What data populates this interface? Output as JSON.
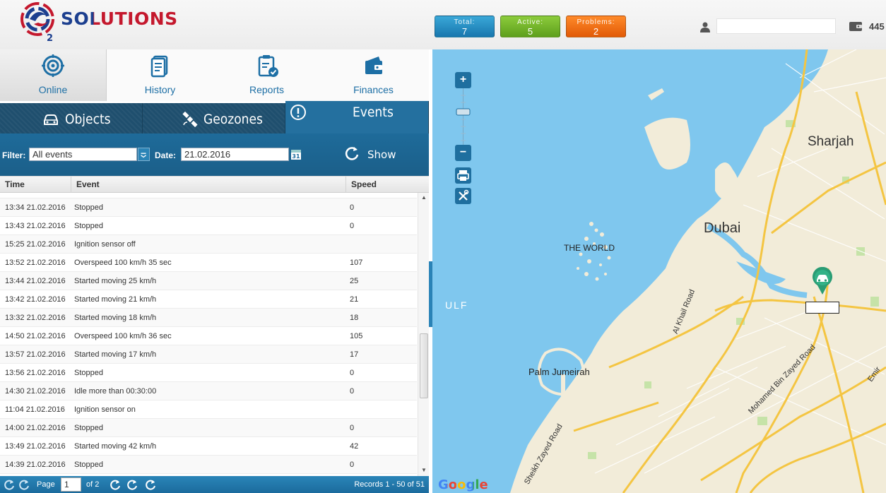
{
  "header": {
    "logo_text": "SOLUTIONS",
    "counters": {
      "total": {
        "label": "Total:",
        "value": "7"
      },
      "active": {
        "label": "Active:",
        "value": "5"
      },
      "problems": {
        "label": "Problems:",
        "value": "2"
      }
    },
    "user_field_value": "",
    "balance": "445"
  },
  "main_tabs": [
    {
      "label": "Online",
      "icon": "target-icon"
    },
    {
      "label": "History",
      "icon": "document-icon"
    },
    {
      "label": "Reports",
      "icon": "clipboard-check-icon"
    },
    {
      "label": "Finances",
      "icon": "wallet-icon"
    }
  ],
  "sub_tabs": [
    {
      "label": "Objects",
      "icon": "car-icon"
    },
    {
      "label": "Geozones",
      "icon": "satellite-icon"
    },
    {
      "label": "Events",
      "icon": "alert-icon"
    }
  ],
  "filter": {
    "filter_label": "Filter:",
    "filter_value": "All events",
    "date_label": "Date:",
    "date_value": "21.02.2016",
    "show_label": "Show"
  },
  "table": {
    "columns": [
      "Time",
      "Event",
      "Speed"
    ],
    "rows": [
      {
        "time": "13:34 21.02.2016",
        "event": "Stopped",
        "speed": "0"
      },
      {
        "time": "13:43 21.02.2016",
        "event": "Stopped",
        "speed": "0"
      },
      {
        "time": "15:25 21.02.2016",
        "event": "Ignition sensor off",
        "speed": ""
      },
      {
        "time": "13:52 21.02.2016",
        "event": "Overspeed 100 km/h 35 sec",
        "speed": "107"
      },
      {
        "time": "13:44 21.02.2016",
        "event": "Started moving 25 km/h",
        "speed": "25"
      },
      {
        "time": "13:42 21.02.2016",
        "event": "Started moving 21 km/h",
        "speed": "21"
      },
      {
        "time": "13:32 21.02.2016",
        "event": "Started moving 18 km/h",
        "speed": "18"
      },
      {
        "time": "14:50 21.02.2016",
        "event": "Overspeed 100 km/h 36 sec",
        "speed": "105"
      },
      {
        "time": "13:57 21.02.2016",
        "event": "Started moving 17 km/h",
        "speed": "17"
      },
      {
        "time": "13:56 21.02.2016",
        "event": "Stopped",
        "speed": "0"
      },
      {
        "time": "14:30 21.02.2016",
        "event": "Idle more than 00:30:00",
        "speed": "0"
      },
      {
        "time": "11:04 21.02.2016",
        "event": "Ignition sensor on",
        "speed": ""
      },
      {
        "time": "14:00 21.02.2016",
        "event": "Stopped",
        "speed": "0"
      },
      {
        "time": "13:49 21.02.2016",
        "event": "Started moving 42 km/h",
        "speed": "42"
      },
      {
        "time": "14:39 21.02.2016",
        "event": "Stopped",
        "speed": "0"
      }
    ]
  },
  "pager": {
    "page_label": "Page",
    "page_value": "1",
    "of_label": "of 2",
    "records_label": "Records 1 - 50 of 51"
  },
  "map": {
    "labels": {
      "sharjah": "Sharjah",
      "dubai": "Dubai",
      "the_world": "THE WORLD",
      "gulf": "ULF",
      "palm": "Palm Jumeirah",
      "al_khail": "Al Khail Road",
      "mohamed": "Mohamed Bin Zayed Road",
      "sheikh": "Sheikh Zayed Road",
      "emir": "Emir"
    },
    "attribution": "Google",
    "colors": {
      "water": "#7fc7ee",
      "land": "#f2ecd9",
      "road": "#f4c542"
    }
  }
}
